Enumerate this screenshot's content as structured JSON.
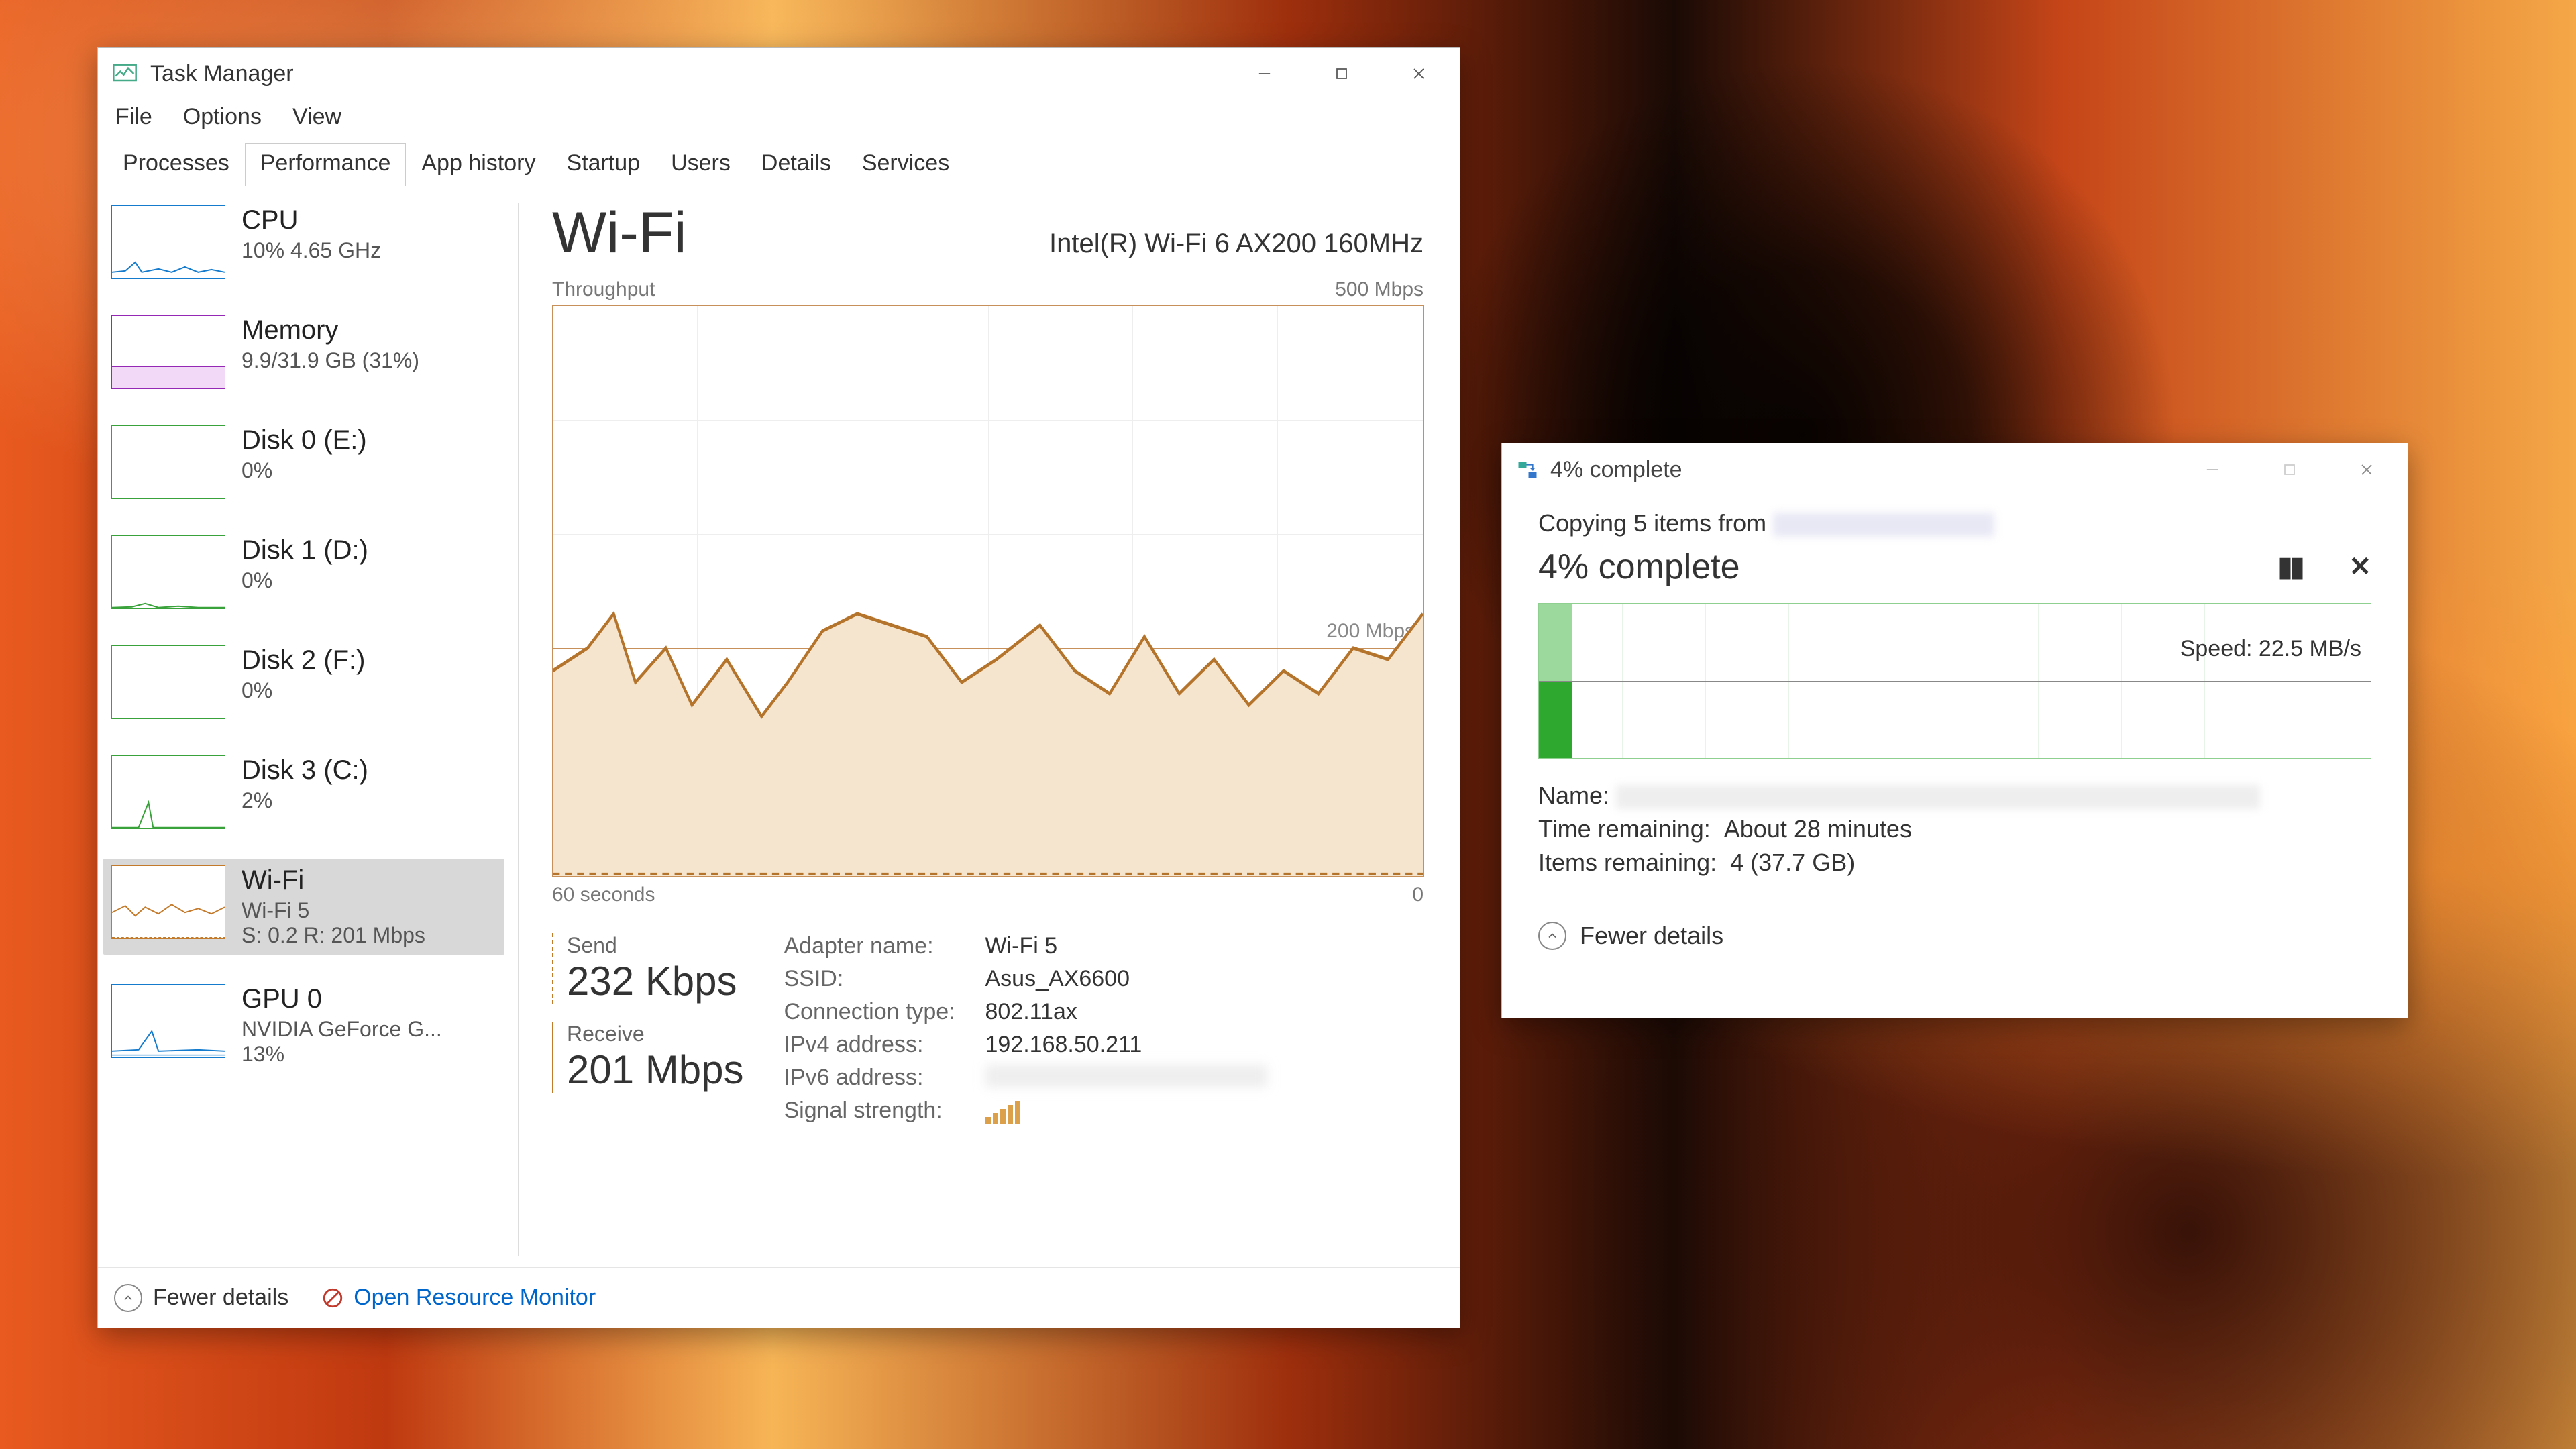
{
  "task_manager": {
    "title": "Task Manager",
    "menu": {
      "file": "File",
      "options": "Options",
      "view": "View"
    },
    "tabs": [
      "Processes",
      "Performance",
      "App history",
      "Startup",
      "Users",
      "Details",
      "Services"
    ],
    "active_tab": 1,
    "sidebar": [
      {
        "name": "CPU",
        "sub": "10%  4.65 GHz",
        "kind": "cpu"
      },
      {
        "name": "Memory",
        "sub": "9.9/31.9 GB (31%)",
        "kind": "mem"
      },
      {
        "name": "Disk 0 (E:)",
        "sub": "0%",
        "kind": "disk"
      },
      {
        "name": "Disk 1 (D:)",
        "sub": "0%",
        "kind": "disk"
      },
      {
        "name": "Disk 2 (F:)",
        "sub": "0%",
        "kind": "disk"
      },
      {
        "name": "Disk 3 (C:)",
        "sub": "2%",
        "kind": "disk"
      },
      {
        "name": "Wi-Fi",
        "sub": "Wi-Fi 5",
        "sub2": "S: 0.2 R: 201 Mbps",
        "kind": "wifi",
        "selected": true
      },
      {
        "name": "GPU 0",
        "sub": "NVIDIA GeForce G...",
        "sub2": "13%",
        "kind": "gpu"
      }
    ],
    "main": {
      "heading": "Wi-Fi",
      "adapter": "Intel(R) Wi-Fi 6 AX200 160MHz",
      "chart_top_left": "Throughput",
      "chart_top_right": "500 Mbps",
      "chart_label_200": "200 Mbps",
      "chart_bot_left": "60 seconds",
      "chart_bot_right": "0",
      "send_label": "Send",
      "send_value": "232 Kbps",
      "recv_label": "Receive",
      "recv_value": "201 Mbps",
      "details": {
        "adapter_name_k": "Adapter name:",
        "adapter_name_v": "Wi-Fi 5",
        "ssid_k": "SSID:",
        "ssid_v": "Asus_AX6600",
        "conn_k": "Connection type:",
        "conn_v": "802.11ax",
        "ipv4_k": "IPv4 address:",
        "ipv4_v": "192.168.50.211",
        "ipv6_k": "IPv6 address:",
        "ipv6_v": "",
        "sig_k": "Signal strength:"
      }
    },
    "footer": {
      "fewer": "Fewer details",
      "orm": "Open Resource Monitor"
    }
  },
  "copy_dialog": {
    "title": "4% complete",
    "copying_line": "Copying 5 items from ",
    "pct_heading": "4% complete",
    "speed": "Speed: 22.5 MB/s",
    "progress_pct": 4,
    "name_k": "Name:",
    "time_k": "Time remaining:",
    "time_v": "About 28 minutes",
    "items_k": "Items remaining:",
    "items_v": "4 (37.7 GB)",
    "fewer": "Fewer details"
  },
  "chart_data": {
    "type": "line",
    "title": "Wi-Fi Throughput",
    "xlabel": "seconds ago",
    "ylabel": "Mbps",
    "ylim": [
      0,
      500
    ],
    "x": [
      60,
      56,
      52,
      48,
      44,
      40,
      36,
      32,
      28,
      24,
      20,
      16,
      12,
      8,
      4,
      0
    ],
    "series": [
      {
        "name": "Receive",
        "values": [
          180,
          220,
          165,
          195,
          150,
          210,
          230,
          215,
          205,
          175,
          215,
          170,
          210,
          185,
          195,
          230
        ]
      },
      {
        "name": "Send",
        "values": [
          0.2,
          0.3,
          0.2,
          0.25,
          0.2,
          0.2,
          0.3,
          0.2,
          0.25,
          0.2,
          0.2,
          0.3,
          0.2,
          0.2,
          0.25,
          0.2
        ]
      }
    ]
  }
}
